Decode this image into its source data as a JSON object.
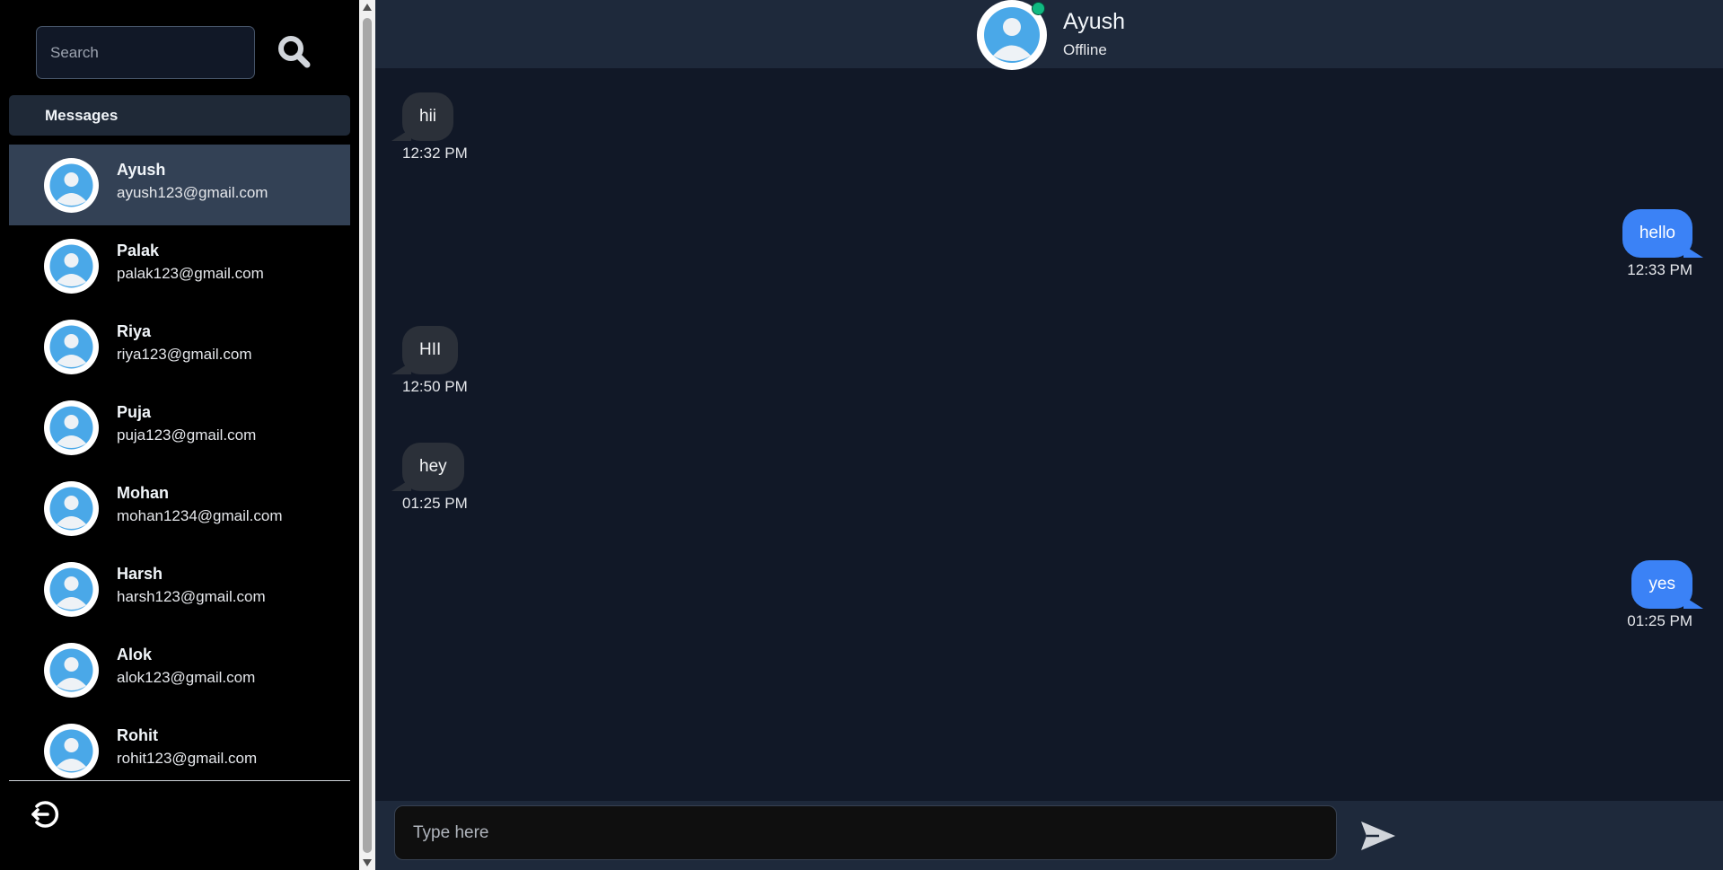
{
  "sidebar": {
    "search": {
      "placeholder": "Search",
      "value": ""
    },
    "messages_label": "Messages",
    "contacts": [
      {
        "name": "Ayush",
        "email": "ayush123@gmail.com",
        "active": true
      },
      {
        "name": "Palak",
        "email": "palak123@gmail.com",
        "active": false
      },
      {
        "name": "Riya",
        "email": "riya123@gmail.com",
        "active": false
      },
      {
        "name": "Puja",
        "email": "puja123@gmail.com",
        "active": false
      },
      {
        "name": "Mohan",
        "email": "mohan1234@gmail.com",
        "active": false
      },
      {
        "name": "Harsh",
        "email": "harsh123@gmail.com",
        "active": false
      },
      {
        "name": "Alok",
        "email": "alok123@gmail.com",
        "active": false
      },
      {
        "name": "Rohit",
        "email": "rohit123@gmail.com",
        "active": false
      }
    ],
    "icons": {
      "search": "search-icon",
      "logout": "logout-icon"
    }
  },
  "chat": {
    "header": {
      "name": "Ayush",
      "status": "Offline",
      "presence_dot_color": "#10b981"
    },
    "messages": [
      {
        "direction": "incoming",
        "text": "hii",
        "time": "12:32 PM"
      },
      {
        "direction": "outgoing",
        "text": "hello",
        "time": "12:33 PM"
      },
      {
        "direction": "incoming",
        "text": "HII",
        "time": "12:50 PM"
      },
      {
        "direction": "incoming",
        "text": "hey",
        "time": "01:25 PM"
      },
      {
        "direction": "outgoing",
        "text": "yes",
        "time": "01:25 PM"
      }
    ],
    "composer": {
      "placeholder": "Type here",
      "value": ""
    },
    "icons": {
      "send": "send-icon"
    }
  },
  "colors": {
    "sidebar_bg": "#000000",
    "chat_bg": "#111827",
    "header_bg": "#1e293b",
    "active_contact_bg": "#334155",
    "incoming_bubble": "#2b3039",
    "outgoing_bubble": "#3b82f6",
    "presence_online": "#10b981"
  }
}
